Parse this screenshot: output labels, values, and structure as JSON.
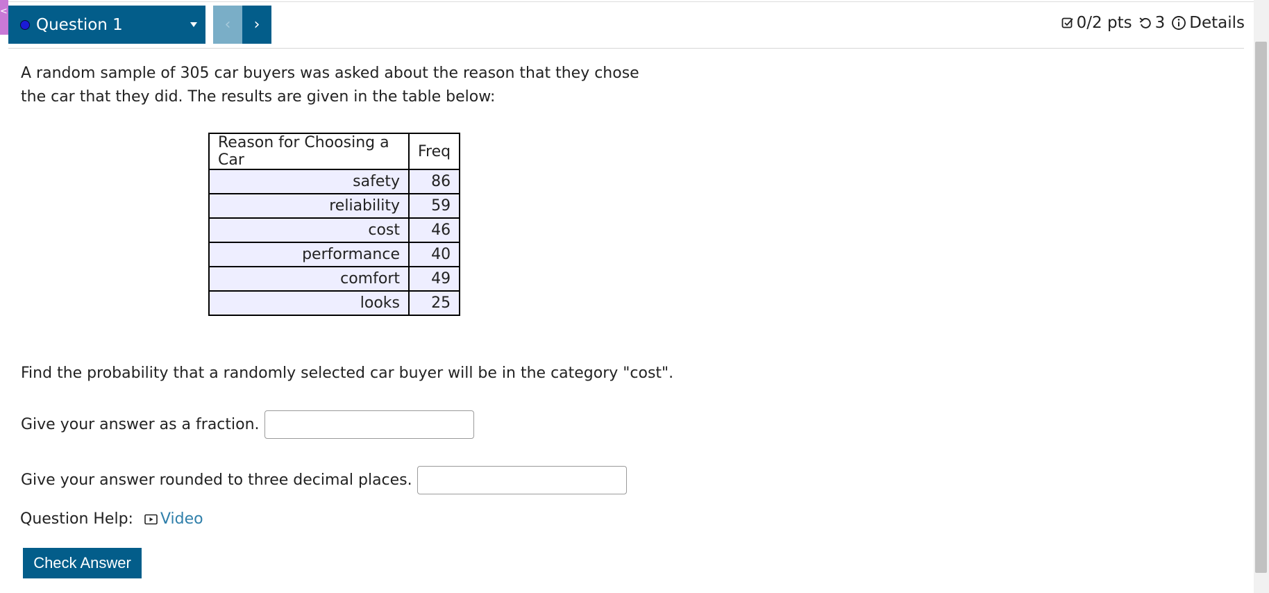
{
  "header": {
    "question_label": "Question 1",
    "prev_glyph": "‹",
    "next_glyph": "›",
    "points": "0/2 pts",
    "attempts": "3",
    "details": "Details",
    "side_tab_glyph": "<"
  },
  "question": {
    "prompt": "A random sample of 305 car buyers was asked about the reason that they chose the car that they did. The results are given in the table below:",
    "table": {
      "headers": [
        "Reason for Choosing a Car",
        "Freq"
      ],
      "rows": [
        [
          "safety",
          "86"
        ],
        [
          "reliability",
          "59"
        ],
        [
          "cost",
          "46"
        ],
        [
          "performance",
          "40"
        ],
        [
          "comfort",
          "49"
        ],
        [
          "looks",
          "25"
        ]
      ]
    },
    "find_text": "Find the probability that a randomly selected car buyer will be in the category \"cost\".",
    "fraction_label": "Give your answer as a fraction.",
    "fraction_value": "",
    "decimal_label": "Give your answer rounded to three decimal places.",
    "decimal_value": "",
    "help_label": "Question Help:",
    "video_label": "Video",
    "check_button": "Check Answer"
  },
  "colors": {
    "primary": "#035d8a",
    "nav_disabled": "#7aaec7",
    "table_cell": "#eeeeff",
    "link": "#2f7faa",
    "side_tab": "#c879d6",
    "dot": "#1b1bd6"
  },
  "icons": {
    "points": "checkbox-icon",
    "attempts": "undo-icon",
    "details": "info-icon",
    "video": "video-icon",
    "dropdown": "caret-down-icon"
  }
}
